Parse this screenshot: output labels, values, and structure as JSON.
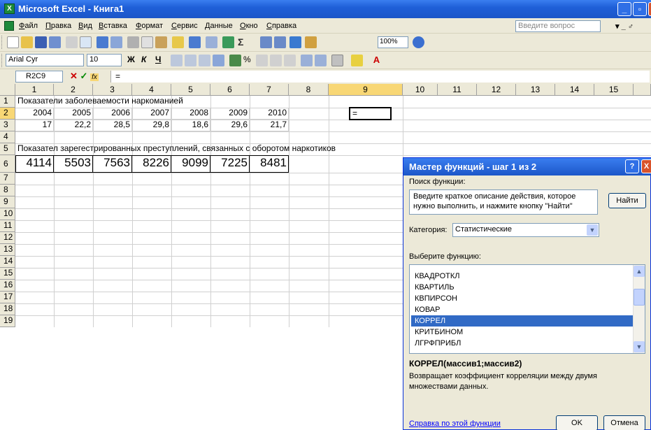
{
  "window": {
    "app_icon": "excel-icon",
    "title": "Microsoft Excel - Книга1",
    "min": "_",
    "max": "▫",
    "close": "✕"
  },
  "menu": {
    "items": [
      "Файл",
      "Правка",
      "Вид",
      "Вставка",
      "Формат",
      "Сервис",
      "Данные",
      "Окно",
      "Справка"
    ],
    "question_placeholder": "Введите вопрос",
    "mdi_controls": "▾ _ ♂"
  },
  "toolbar": {
    "zoom": "100%",
    "font_name": "Arial Cyr",
    "font_size": "10",
    "bold": "Ж",
    "italic": "К",
    "underline": "Ч"
  },
  "formula_bar": {
    "name_box": "R2C9",
    "cancel": "✕",
    "enter": "✓",
    "fx": "fx",
    "content": "="
  },
  "grid": {
    "columns": [
      "1",
      "2",
      "3",
      "4",
      "5",
      "6",
      "7",
      "8",
      "9",
      "10",
      "11",
      "12",
      "13",
      "14",
      "15"
    ],
    "selected_column": "9",
    "rows": [
      "1",
      "2",
      "3",
      "4",
      "5",
      "6",
      "7",
      "8",
      "9",
      "10",
      "11",
      "12",
      "13",
      "14",
      "15",
      "16",
      "17",
      "18",
      "19"
    ],
    "selected_row": "2",
    "r1_text": "Показатели заболеваемости наркоманией",
    "years": [
      "2004",
      "2005",
      "2006",
      "2007",
      "2008",
      "2009",
      "2010"
    ],
    "rates": [
      "17",
      "22,2",
      "28,5",
      "29,8",
      "18,6",
      "29,6",
      "21,7"
    ],
    "active_cell": "=",
    "r5_text": "Показател зарегестрированных преступлений, связанных с оборотом наркотиков",
    "crimes": [
      "4114",
      "5503",
      "7563",
      "8226",
      "9099",
      "7225",
      "8481"
    ]
  },
  "dialog": {
    "title": "Мастер функций - шаг 1 из 2",
    "help": "?",
    "close": "X",
    "search_label": "Поиск функции:",
    "search_text": "Введите краткое описание действия, которое нужно выполнить, и нажмите кнопку \"Найти\"",
    "find_button": "Найти",
    "category_label": "Категория:",
    "category_value": "Статистические",
    "choose_label": "Выберите функцию:",
    "functions": [
      "КВАДРОТКЛ",
      "КВАРТИЛЬ",
      "КВПИРСОН",
      "КОВАР",
      "КОРРЕЛ",
      "КРИТБИНОМ",
      "ЛГРФПРИБЛ"
    ],
    "selected_function": "КОРРЕЛ",
    "signature": "КОРРЕЛ(массив1;массив2)",
    "description": "Возвращает коэффициент корреляции между двумя множествами данных.",
    "help_link": "Справка по этой функции",
    "ok": "OK",
    "cancel": "Отмена"
  }
}
